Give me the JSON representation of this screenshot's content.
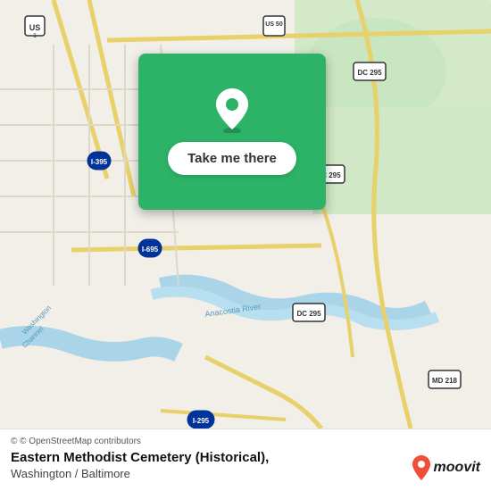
{
  "map": {
    "background_color": "#f2efe9"
  },
  "action_card": {
    "button_label": "Take me there",
    "background_color": "#2db368"
  },
  "bottom_bar": {
    "attribution_text": "© OpenStreetMap contributors",
    "location_title": "Eastern Methodist Cemetery (Historical),",
    "location_subtitle": "Washington / Baltimore"
  },
  "moovit": {
    "logo_text": "moovit"
  },
  "icons": {
    "location_pin": "📍"
  }
}
